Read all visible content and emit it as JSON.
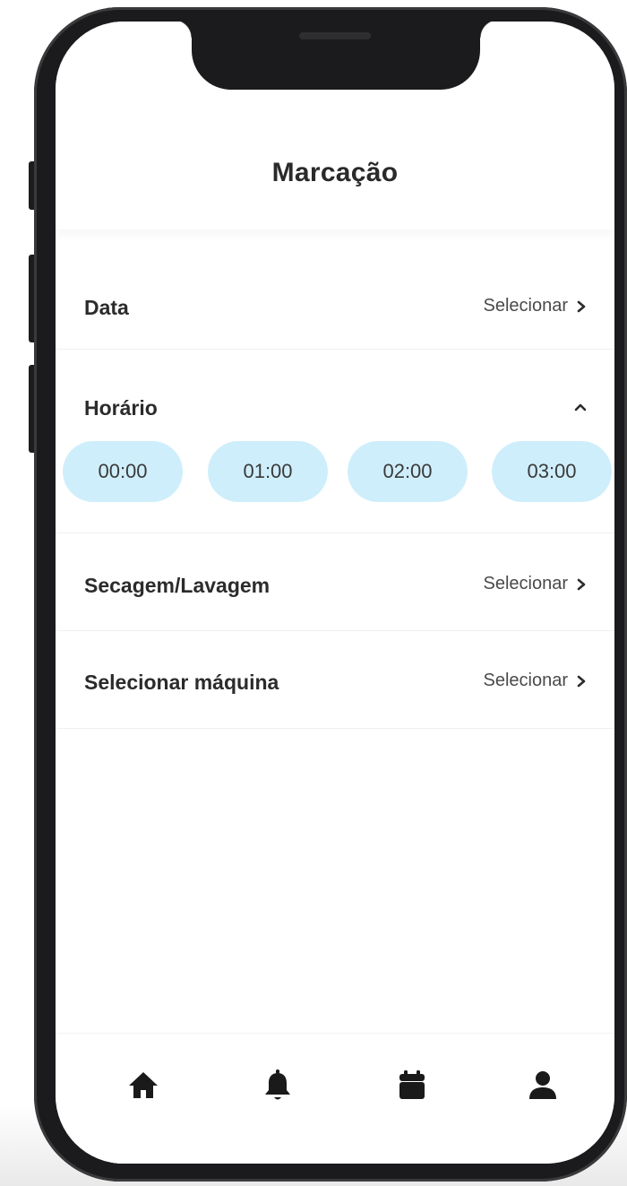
{
  "screen": {
    "title": "Marcação"
  },
  "rows": {
    "data": {
      "label": "Data",
      "action": "Selecionar"
    },
    "horario": {
      "label": "Horário",
      "times": [
        "00:00",
        "01:00",
        "02:00",
        "03:00"
      ]
    },
    "secagem": {
      "label": "Secagem/Lavagem",
      "action": "Selecionar"
    },
    "maquina": {
      "label": "Selecionar máquina",
      "action": "Selecionar"
    }
  },
  "tabbar": {
    "items": [
      {
        "icon": "home-icon"
      },
      {
        "icon": "bell-icon"
      },
      {
        "icon": "calendar-icon"
      },
      {
        "icon": "user-icon"
      }
    ]
  },
  "colors": {
    "chip_background": "#cfeefb",
    "text_primary": "#2b2b2b",
    "phone_frame": "#1b1b1d"
  }
}
